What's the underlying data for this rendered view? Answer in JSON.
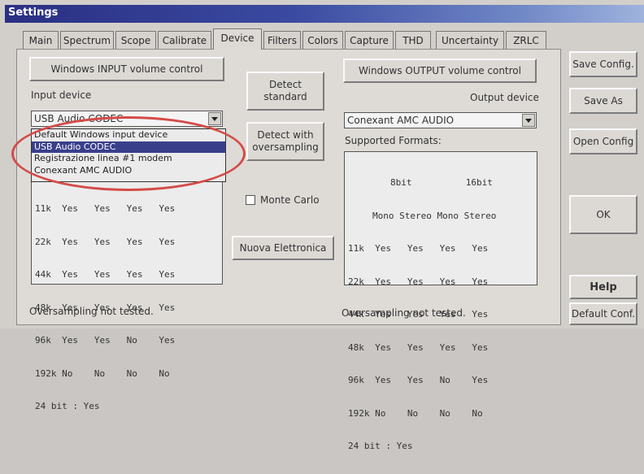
{
  "window": {
    "title": "Settings"
  },
  "tabs": [
    {
      "label": "Main"
    },
    {
      "label": "Spectrum"
    },
    {
      "label": "Scope"
    },
    {
      "label": "Calibrate"
    },
    {
      "label": "Device",
      "active": true
    },
    {
      "label": "Filters"
    },
    {
      "label": "Colors"
    },
    {
      "label": "Capture"
    },
    {
      "label": "THD"
    },
    {
      "label": "Uncertainty"
    },
    {
      "label": "ZRLC"
    }
  ],
  "input": {
    "volume_button": "Windows INPUT volume control",
    "device_label": "Input device",
    "selected": "USB Audio CODEC",
    "options": [
      "Default Windows input device",
      "USB Audio CODEC",
      "Registrazione linea #1 modem",
      "Conexant AMC AUDIO"
    ],
    "formats_rows": [
      "11k  Yes   Yes   Yes   Yes",
      "22k  Yes   Yes   Yes   Yes",
      "44k  Yes   Yes   Yes   Yes",
      "48k  Yes   Yes   Yes   Yes",
      "96k  Yes   Yes   No    Yes",
      "192k No    No    No    No",
      "24 bit : Yes"
    ],
    "oversampling_status": "Oversampling not tested."
  },
  "middle": {
    "detect_standard": "Detect standard",
    "detect_oversampling": "Detect with oversampling",
    "monte_carlo_label": "Monte Carlo",
    "nuova_button": "Nuova Elettronica"
  },
  "output": {
    "volume_button": "Windows OUTPUT volume control",
    "device_label": "Output device",
    "selected": "Conexant AMC AUDIO",
    "formats_label": "Supported Formats:",
    "header_bits": "8bit          16bit",
    "header_modes": "Mono Stereo Mono Stereo",
    "formats_rows": [
      "11k  Yes   Yes   Yes   Yes",
      "22k  Yes   Yes   Yes   Yes",
      "44k  Yes   Yes   Yes   Yes",
      "48k  Yes   Yes   Yes   Yes",
      "96k  Yes   Yes   No    Yes",
      "192k No    No    No    No",
      "24 bit : Yes"
    ],
    "oversampling_status": "Oversampling not tested."
  },
  "right": {
    "save_config": "Save Config.",
    "save_as": "Save As",
    "open_config": "Open Config",
    "ok": "OK",
    "help": "Help",
    "default_conf": "Default Conf."
  },
  "colors": {
    "highlight_ring": "#d44b48",
    "selection": "#3a3f8c",
    "titlebar": "#2a2f83"
  }
}
